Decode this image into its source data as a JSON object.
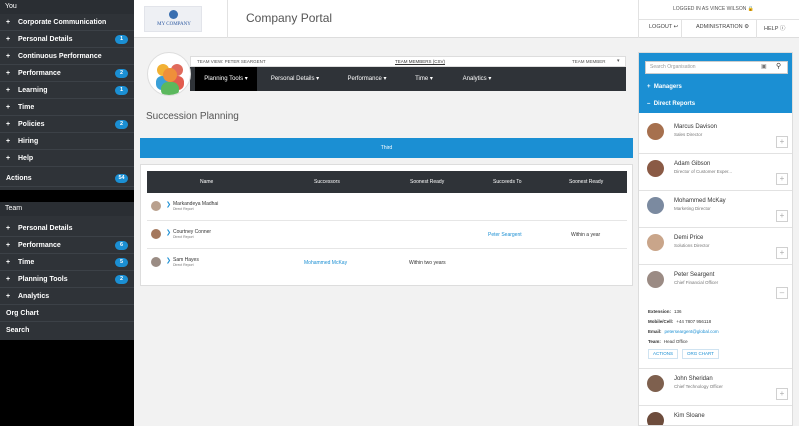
{
  "sidebar": {
    "you_header": "You",
    "you_items": [
      {
        "label": "Corporate Communication",
        "badge": ""
      },
      {
        "label": "Personal Details",
        "badge": "1"
      },
      {
        "label": "Continuous Performance",
        "badge": ""
      },
      {
        "label": "Performance",
        "badge": "2"
      },
      {
        "label": "Learning",
        "badge": "1"
      },
      {
        "label": "Time",
        "badge": ""
      },
      {
        "label": "Policies",
        "badge": "2"
      },
      {
        "label": "Hiring",
        "badge": ""
      },
      {
        "label": "Help",
        "badge": ""
      }
    ],
    "actions_label": "Actions",
    "actions_badge": "54",
    "team_header": "Team",
    "team_items": [
      {
        "label": "Personal Details",
        "badge": ""
      },
      {
        "label": "Performance",
        "badge": "6"
      },
      {
        "label": "Time",
        "badge": "5"
      },
      {
        "label": "Planning Tools",
        "badge": "2"
      },
      {
        "label": "Analytics",
        "badge": ""
      }
    ],
    "org_chart": "Org Chart",
    "search": "Search"
  },
  "header": {
    "logo_text": "MY COMPANY",
    "title": "Company Portal",
    "logged_in": "LOGGED IN AS VINCE WILSON",
    "logout": "LOGOUT",
    "administration": "ADMINISTRATION",
    "help": "HELP"
  },
  "team_bar": {
    "team_view": "TEAM VIEW: PETER SEARGENT",
    "team_link": "TEAM MEMBERS (CSV)",
    "team_member": "TEAM MEMBER"
  },
  "tabs": [
    {
      "label": "Planning Tools",
      "active": true
    },
    {
      "label": "Personal Details",
      "active": false
    },
    {
      "label": "Performance",
      "active": false
    },
    {
      "label": "Time",
      "active": false
    },
    {
      "label": "Analytics",
      "active": false
    }
  ],
  "page_title": "Succession Planning",
  "band_text": "Third",
  "table": {
    "headers": [
      "Name",
      "Successors",
      "Soonest Ready",
      "Succeeds To",
      "Soonest Ready"
    ],
    "rows": [
      {
        "name": "Markandeya Madhai",
        "sub": "Direct Report",
        "successor": "",
        "ready": "",
        "succeeds": "",
        "ready2": ""
      },
      {
        "name": "Courtney Conner",
        "sub": "Direct Report",
        "successor": "",
        "ready": "",
        "succeeds": "Peter Seargent",
        "ready2": "Within a year"
      },
      {
        "name": "Sam Hayes",
        "sub": "Direct Report",
        "successor": "Mohammed McKay",
        "ready": "Within two years",
        "succeeds": "",
        "ready2": ""
      }
    ]
  },
  "right_panel": {
    "search_placeholder": "Search Organisation",
    "managers": "Managers",
    "direct_reports": "Direct Reports",
    "people": [
      {
        "name": "Marcus Davison",
        "title": "Sales Director"
      },
      {
        "name": "Adam Gibson",
        "title": "Director of Customer Exper..."
      },
      {
        "name": "Mohammed McKay",
        "title": "Marketing Director"
      },
      {
        "name": "Demi Price",
        "title": "Solutions Director"
      },
      {
        "name": "Peter Seargent",
        "title": "Chief Financial Officer"
      }
    ],
    "details": {
      "extension_label": "Extension:",
      "extension": "136",
      "mobile_label": "Mobile/Cell:",
      "mobile": "+44 7807 956118",
      "email_label": "Email:",
      "email": "peterseargent@global.com",
      "team_label": "Team:",
      "team": "Head Office",
      "actions_btn": "ACTIONS",
      "org_btn": "ORG CHART"
    },
    "more_people": [
      {
        "name": "John Sheridan",
        "title": "Chief Technology Officer"
      },
      {
        "name": "Kim Sloane",
        "title": ""
      }
    ]
  }
}
